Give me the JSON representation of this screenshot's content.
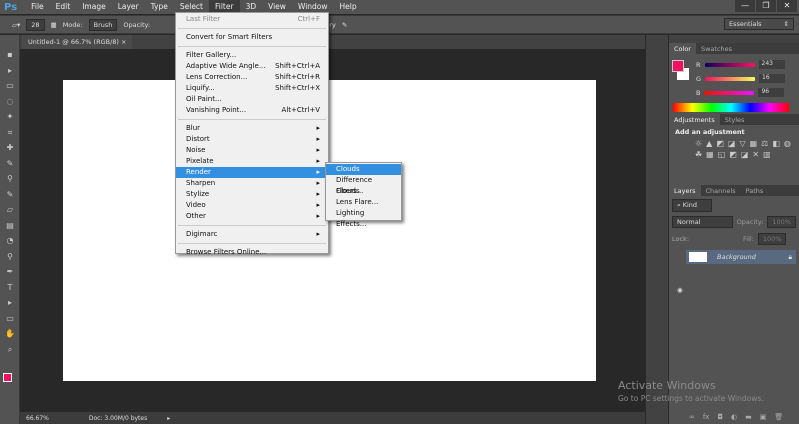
{
  "app": {
    "logo": "Ps"
  },
  "menubar": [
    "File",
    "Edit",
    "Image",
    "Layer",
    "Type",
    "Select",
    "Filter",
    "3D",
    "View",
    "Window",
    "Help"
  ],
  "window_buttons": [
    "—",
    "❐",
    "✕"
  ],
  "options": {
    "brush_size": "28",
    "mode_label": "Mode:",
    "mode_value": "Brush",
    "opacity_label": "Opacity:",
    "history_label": "to History",
    "workspace": "Essentials"
  },
  "document": {
    "tab": "Untitled-1 @ 66.7% (RGB/8)",
    "close": "×"
  },
  "status": {
    "zoom": "66.67%",
    "doc": "Doc: 3.00M/0 bytes"
  },
  "filter_menu": [
    {
      "label": "Last Filter",
      "shortcut": "Ctrl+F",
      "disabled": true
    },
    {
      "sep": true
    },
    {
      "label": "Convert for Smart Filters"
    },
    {
      "sep": true
    },
    {
      "label": "Filter Gallery..."
    },
    {
      "label": "Adaptive Wide Angle...",
      "shortcut": "Shift+Ctrl+A"
    },
    {
      "label": "Lens Correction...",
      "shortcut": "Shift+Ctrl+R"
    },
    {
      "label": "Liquify...",
      "shortcut": "Shift+Ctrl+X"
    },
    {
      "label": "Oil Paint..."
    },
    {
      "label": "Vanishing Point...",
      "shortcut": "Alt+Ctrl+V"
    },
    {
      "sep": true
    },
    {
      "label": "Blur",
      "sub": true
    },
    {
      "label": "Distort",
      "sub": true
    },
    {
      "label": "Noise",
      "sub": true
    },
    {
      "label": "Pixelate",
      "sub": true
    },
    {
      "label": "Render",
      "sub": true,
      "highlight": true
    },
    {
      "label": "Sharpen",
      "sub": true
    },
    {
      "label": "Stylize",
      "sub": true
    },
    {
      "label": "Video",
      "sub": true
    },
    {
      "label": "Other",
      "sub": true
    },
    {
      "sep": true
    },
    {
      "label": "Digimarc",
      "sub": true
    },
    {
      "sep": true
    },
    {
      "label": "Browse Filters Online..."
    }
  ],
  "render_submenu": [
    {
      "label": "Clouds",
      "highlight": true
    },
    {
      "label": "Difference Clouds"
    },
    {
      "label": "Fibers..."
    },
    {
      "label": "Lens Flare..."
    },
    {
      "label": "Lighting Effects..."
    }
  ],
  "color_panel": {
    "tabs": [
      "Color",
      "Swatches"
    ],
    "r_label": "R",
    "r": "243",
    "g_label": "G",
    "g": "16",
    "b_label": "B",
    "b": "96",
    "fg": "#f31060"
  },
  "adjustments": {
    "tabs": [
      "Adjustments",
      "Styles"
    ],
    "title": "Add an adjustment"
  },
  "layers": {
    "tabs": [
      "Layers",
      "Channels",
      "Paths"
    ],
    "kind": "Kind",
    "blend": "Normal",
    "opacity_label": "Opacity:",
    "opacity": "100%",
    "lock_label": "Lock:",
    "fill_label": "Fill:",
    "fill": "100%",
    "layer_name": "Background"
  },
  "watermark": {
    "title": "Activate Windows",
    "sub": "Go to PC settings to activate Windows."
  }
}
